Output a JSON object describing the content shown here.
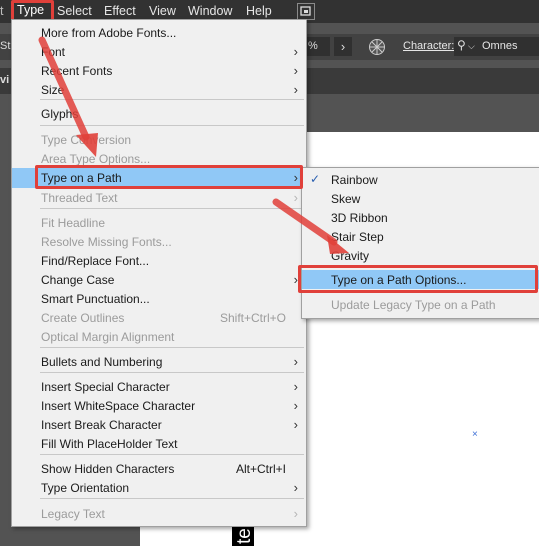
{
  "menubar": {
    "items": [
      "Type",
      "Select",
      "Effect",
      "View",
      "Window",
      "Help"
    ],
    "left_edge": "t"
  },
  "control_bar": {
    "left_fragment": "Str",
    "percent_fragment": "%",
    "character_label": "Character:",
    "font_value": "Omnes"
  },
  "doc_tab_fragment": "vi",
  "type_menu": {
    "items": [
      {
        "label": "More from Adobe Fonts...",
        "disabled": false,
        "submenu": false
      },
      {
        "label": "Font",
        "disabled": false,
        "submenu": true
      },
      {
        "label": "Recent Fonts",
        "disabled": false,
        "submenu": true
      },
      {
        "label": "Size",
        "disabled": false,
        "submenu": true
      },
      {
        "label": "Glyphs",
        "disabled": false,
        "submenu": false
      },
      {
        "label": "Type Conversion",
        "disabled": true,
        "submenu": false
      },
      {
        "label": "Area Type Options...",
        "disabled": true,
        "submenu": false
      },
      {
        "label": "Type on a Path",
        "disabled": false,
        "submenu": true,
        "highlighted": true
      },
      {
        "label": "Threaded Text",
        "disabled": true,
        "submenu": true
      },
      {
        "label": "Fit Headline",
        "disabled": true,
        "submenu": false
      },
      {
        "label": "Resolve Missing Fonts...",
        "disabled": true,
        "submenu": false
      },
      {
        "label": "Find/Replace Font...",
        "disabled": false,
        "submenu": false
      },
      {
        "label": "Change Case",
        "disabled": false,
        "submenu": true
      },
      {
        "label": "Smart Punctuation...",
        "disabled": false,
        "submenu": false
      },
      {
        "label": "Create Outlines",
        "disabled": true,
        "submenu": false,
        "shortcut": "Shift+Ctrl+O"
      },
      {
        "label": "Optical Margin Alignment",
        "disabled": true,
        "submenu": false
      },
      {
        "label": "Bullets and Numbering",
        "disabled": false,
        "submenu": true
      },
      {
        "label": "Insert Special Character",
        "disabled": false,
        "submenu": true
      },
      {
        "label": "Insert WhiteSpace Character",
        "disabled": false,
        "submenu": true
      },
      {
        "label": "Insert Break Character",
        "disabled": false,
        "submenu": true
      },
      {
        "label": "Fill With PlaceHolder Text",
        "disabled": false,
        "submenu": false
      },
      {
        "label": "Show Hidden Characters",
        "disabled": false,
        "submenu": false,
        "shortcut": "Alt+Ctrl+I"
      },
      {
        "label": "Type Orientation",
        "disabled": false,
        "submenu": true
      },
      {
        "label": "Legacy Text",
        "disabled": true,
        "submenu": true
      }
    ]
  },
  "path_submenu": {
    "items": [
      {
        "label": "Rainbow",
        "checked": true
      },
      {
        "label": "Skew"
      },
      {
        "label": "3D Ribbon"
      },
      {
        "label": "Stair Step"
      },
      {
        "label": "Gravity"
      },
      {
        "label": "Type on a Path Options...",
        "highlighted": true
      },
      {
        "label": "Update Legacy Type on a Path",
        "disabled": true
      }
    ]
  },
  "canvas": {
    "vertical_text_fragment": "te",
    "marker": "×"
  },
  "colors": {
    "highlight": "#90c8f6",
    "annotation_red": "#e0403a",
    "menu_bg": "#f0f0f0",
    "disabled_text": "#9b9b9b"
  }
}
